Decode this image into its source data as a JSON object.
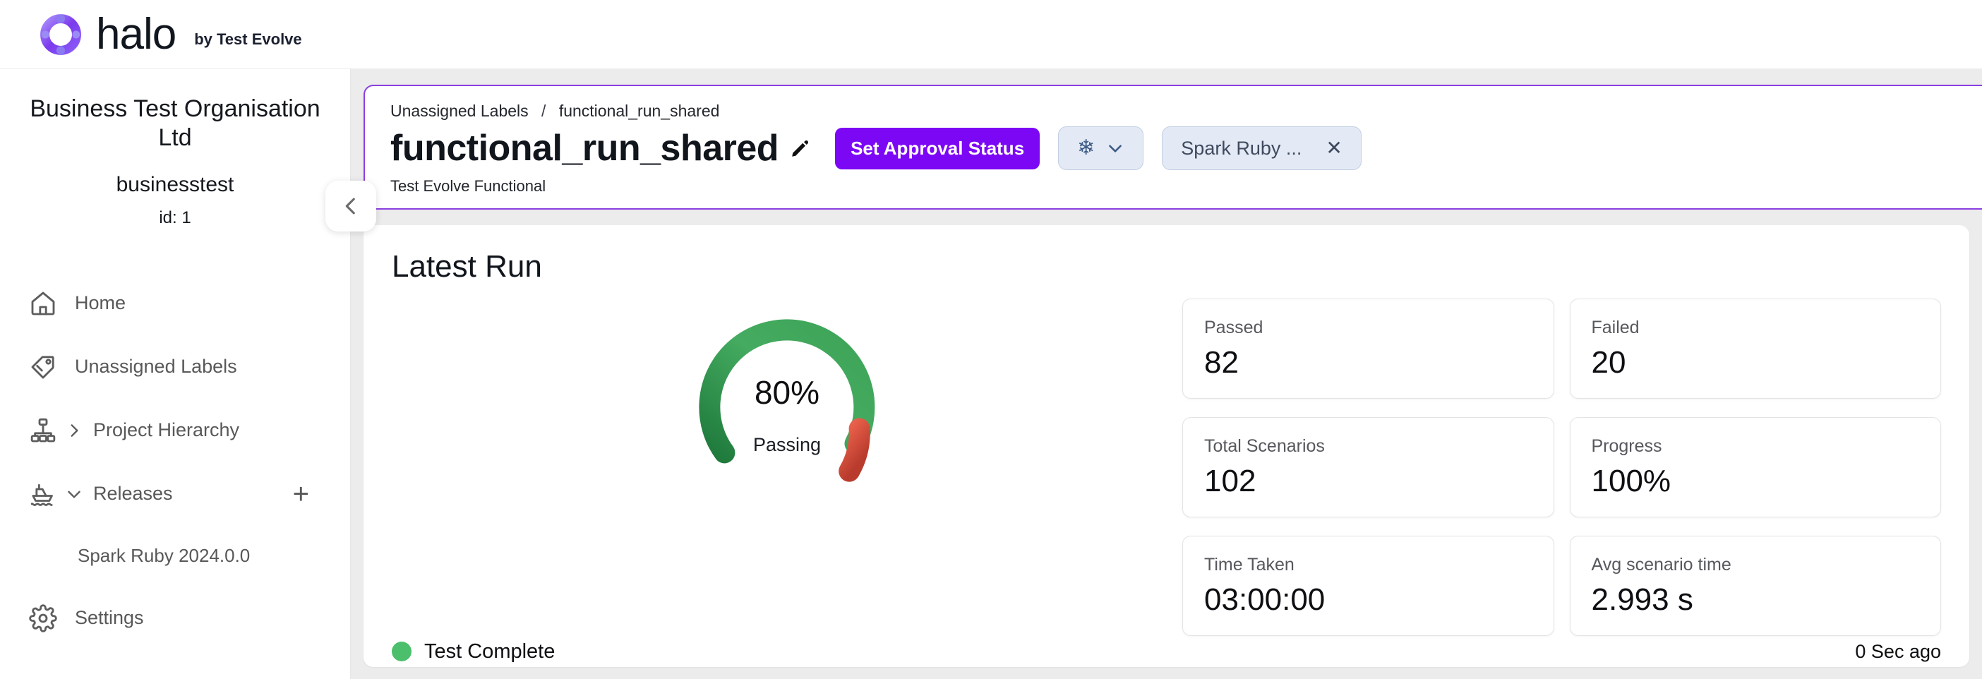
{
  "brand": {
    "name": "halo",
    "tagline": "by Test Evolve",
    "logo_colors": [
      "#7c3aed",
      "#8b5cf6",
      "#a78bfa"
    ]
  },
  "sidebar": {
    "organisation": "Business Test Organisation Ltd",
    "handle": "businesstest",
    "id_label": "id: 1",
    "items": [
      {
        "label": "Home",
        "icon": "home-icon",
        "chevron": null,
        "plus": false
      },
      {
        "label": "Unassigned Labels",
        "icon": "tag-icon",
        "chevron": null,
        "plus": false
      },
      {
        "label": "Project Hierarchy",
        "icon": "hierarchy-icon",
        "chevron": "right",
        "plus": false
      },
      {
        "label": "Releases",
        "icon": "ship-icon",
        "chevron": "down",
        "plus": true
      }
    ],
    "release_child": "Spark Ruby 2024.0.0",
    "settings": {
      "label": "Settings",
      "icon": "gear-icon"
    },
    "add_symbol": "+"
  },
  "header": {
    "breadcrumb": {
      "parent": "Unassigned Labels",
      "separator": "/",
      "current": "functional_run_shared"
    },
    "title": "functional_run_shared",
    "edit_icon": "pencil-icon",
    "approval_button": "Set Approval Status",
    "environment_button": {
      "icon": "snowflake-icon",
      "glyph": "❄",
      "chevron": "chevron-down-icon"
    },
    "release_chip": {
      "label": "Spark Ruby ...",
      "close": "✕"
    },
    "subtitle": "Test Evolve Functional",
    "accent_color": "#8b3fe0",
    "approval_button_color": "#7c07f5"
  },
  "main": {
    "card_title": "Latest Run",
    "stats": [
      {
        "label": "Passed",
        "value": "82"
      },
      {
        "label": "Failed",
        "value": "20"
      },
      {
        "label": "Total Scenarios",
        "value": "102"
      },
      {
        "label": "Progress",
        "value": "100%"
      },
      {
        "label": "Time Taken",
        "value": "03:00:00"
      },
      {
        "label": "Avg scenario time",
        "value": "2.993 s"
      }
    ],
    "footer": {
      "status": "Test Complete",
      "status_color": "#4cbf6d",
      "timestamp": "0 Sec ago"
    }
  },
  "chart_data": {
    "type": "pie",
    "title": "Passing",
    "center_value": "80%",
    "center_label": "Passing",
    "values": [
      80,
      20
    ],
    "categories": [
      "Passing",
      "Failing"
    ],
    "colors": [
      "#2e9e52",
      "#dd5645"
    ],
    "gradient_passing": [
      "#44ab60",
      "#1f7a3c"
    ],
    "gradient_failing": [
      "#e8604a",
      "#b93b2d"
    ],
    "shape": "gauge-arc",
    "arc_span_degrees": 270,
    "legend": "none",
    "grid": false
  }
}
